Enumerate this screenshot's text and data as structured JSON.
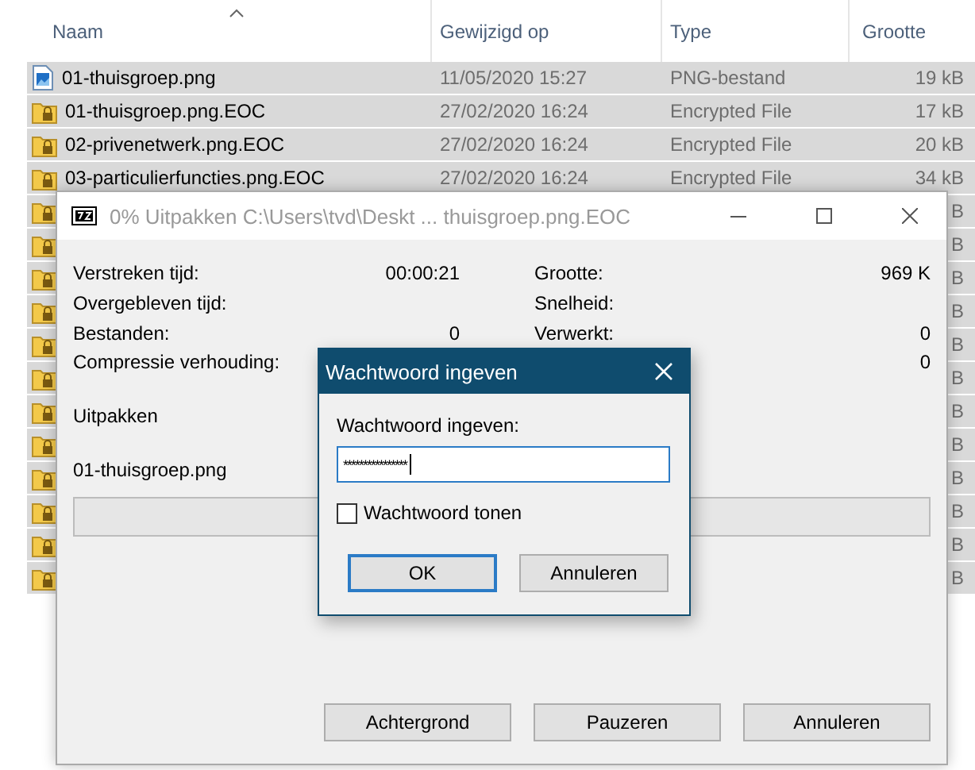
{
  "explorer": {
    "columns": [
      {
        "label": "Naam",
        "sorted": true
      },
      {
        "label": "Gewijzigd op",
        "sorted": false
      },
      {
        "label": "Type",
        "sorted": false
      },
      {
        "label": "Grootte",
        "sorted": false
      }
    ],
    "rows": [
      {
        "kind": "image",
        "name": "01-thuisgroep.png",
        "modified": "11/05/2020 15:27",
        "type": "PNG-bestand",
        "size": "19 kB",
        "selected": true
      },
      {
        "kind": "locked",
        "name": "01-thuisgroep.png.EOC",
        "modified": "27/02/2020 16:24",
        "type": "Encrypted File",
        "size": "17 kB",
        "selected": true
      },
      {
        "kind": "locked",
        "name": "02-privenetwerk.png.EOC",
        "modified": "27/02/2020 16:24",
        "type": "Encrypted File",
        "size": "20 kB",
        "selected": true
      },
      {
        "kind": "locked",
        "name": "03-particulierfuncties.png.EOC",
        "modified": "27/02/2020 16:24",
        "type": "Encrypted File",
        "size": "34 kB",
        "selected": true
      },
      {
        "kind": "locked",
        "size": "B",
        "selected": true
      },
      {
        "kind": "locked",
        "size": "B",
        "selected": true
      },
      {
        "kind": "locked",
        "size": "B",
        "selected": true
      },
      {
        "kind": "locked",
        "size": "B",
        "selected": true
      },
      {
        "kind": "locked",
        "size": "B",
        "selected": true
      },
      {
        "kind": "locked",
        "size": "B",
        "selected": true
      },
      {
        "kind": "locked",
        "size": "B",
        "selected": true
      },
      {
        "kind": "locked",
        "size": "B",
        "selected": true
      },
      {
        "kind": "locked",
        "size": "B",
        "selected": true
      },
      {
        "kind": "locked",
        "size": "B",
        "selected": true
      },
      {
        "kind": "locked",
        "size": "B",
        "selected": true
      },
      {
        "kind": "locked",
        "size": "B",
        "selected": true
      }
    ]
  },
  "progress_window": {
    "title": "0% Uitpakken C:\\Users\\tvd\\Deskt ... thuisgroep.png.EOC",
    "stats_left": [
      {
        "label": "Verstreken tijd:",
        "value": "00:00:21"
      },
      {
        "label": "Overgebleven tijd:"
      },
      {
        "label": "Bestanden:",
        "value": "0"
      },
      {
        "label": "Compressie verhouding:"
      }
    ],
    "stats_right": [
      {
        "label": "Grootte:",
        "value": "969 K"
      },
      {
        "label": "Snelheid:"
      },
      {
        "label": "Verwerkt:",
        "value": "0"
      },
      {
        "value": "0"
      }
    ],
    "action": "Uitpakken",
    "current_file": "01-thuisgroep.png",
    "level": 0,
    "buttons": [
      "Achtergrond",
      "Pauzeren",
      "Annuleren"
    ]
  },
  "password_dialog": {
    "title": "Wachtwoord ingeven",
    "label": "Wachtwoord ingeven:",
    "value": "****************",
    "show_password": {
      "label": "Wachtwoord tonen",
      "checked": false
    },
    "buttons": [
      {
        "label": "OK",
        "default": true
      },
      {
        "label": "Annuleren",
        "default": false
      }
    ]
  }
}
